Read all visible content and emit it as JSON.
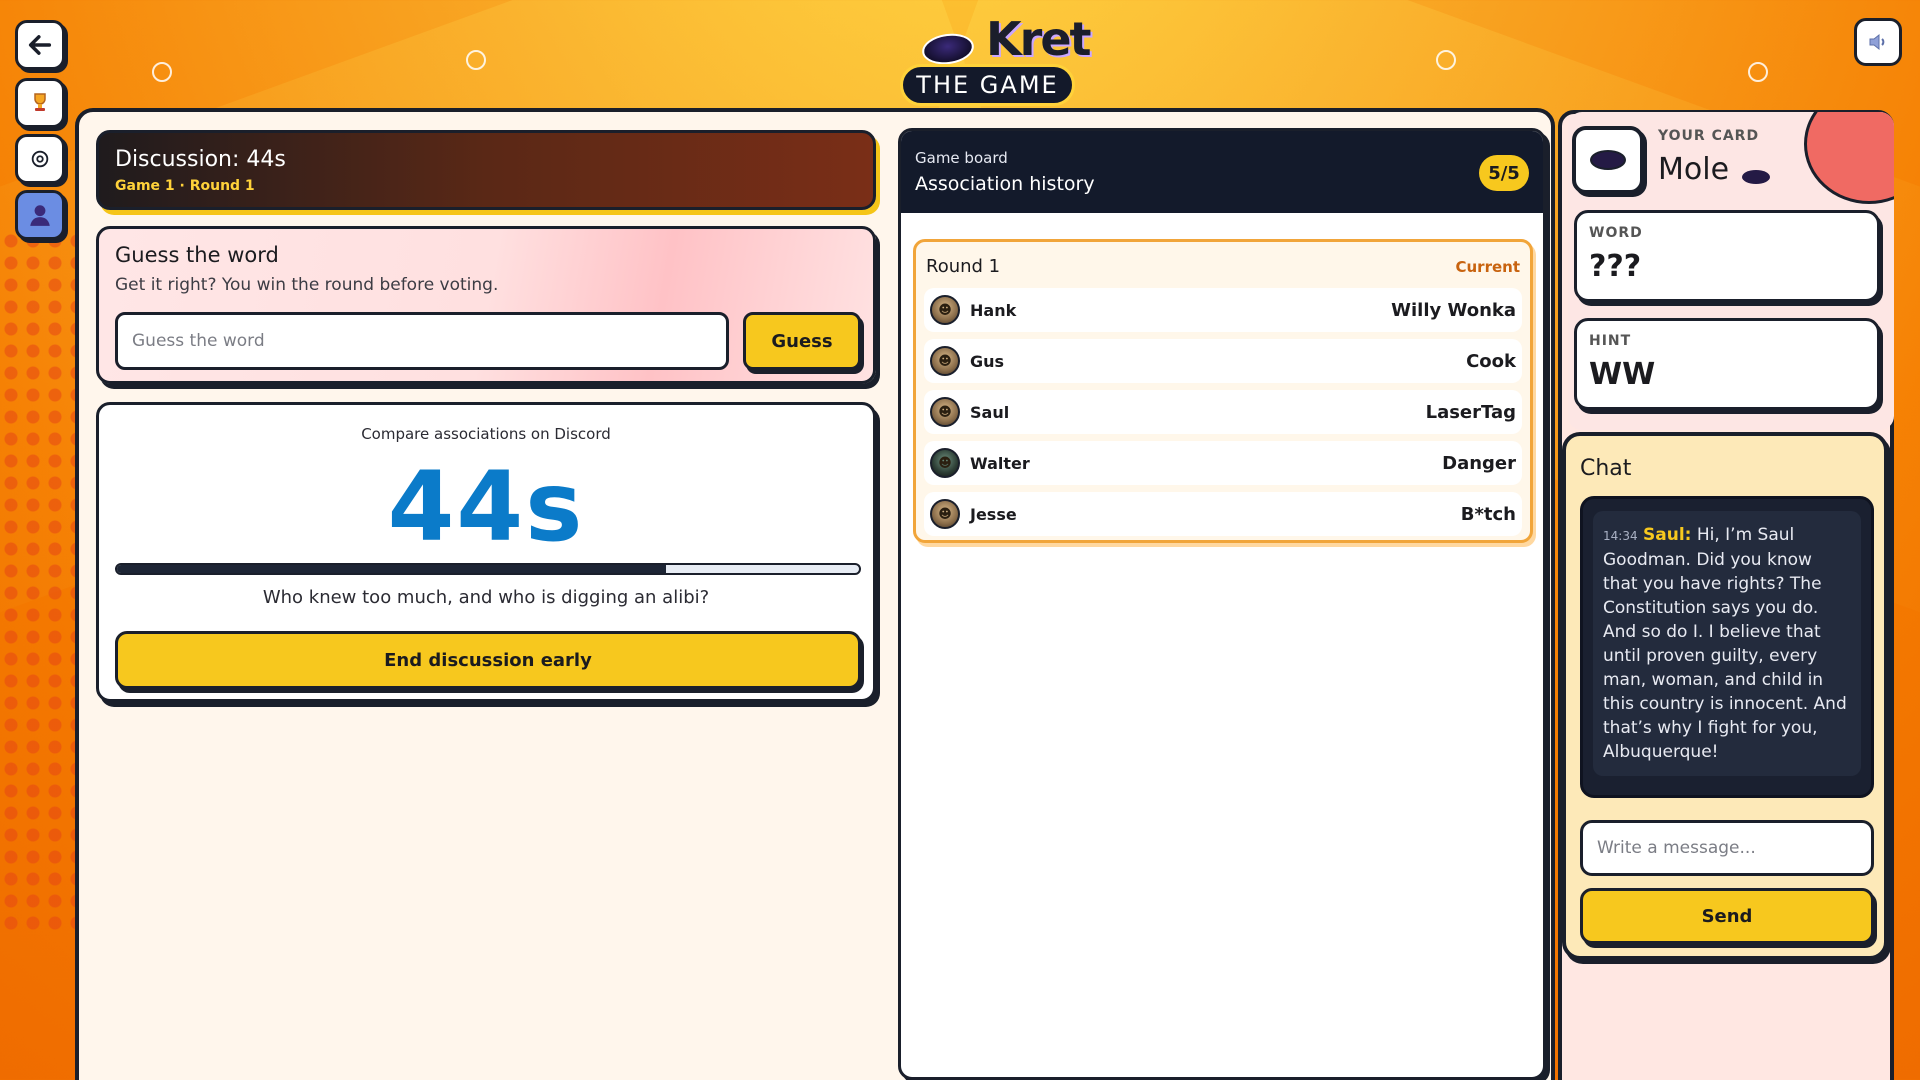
{
  "logo": {
    "brand": "Kret",
    "subtitle": "THE GAME"
  },
  "rail": {
    "back_icon": "arrow-left-icon",
    "trophy_icon": "trophy-icon",
    "settings_icon": "gear-icon",
    "profile_icon": "user-icon"
  },
  "sound_icon": "speaker-icon",
  "discussion": {
    "title": "Discussion: 44s",
    "subtitle": "Game 1 · Round 1"
  },
  "guess": {
    "title": "Guess the word",
    "description": "Get it right? You win the round before voting.",
    "input_placeholder": "Guess the word",
    "input_value": "",
    "button_label": "Guess"
  },
  "timer": {
    "caption": "Compare associations on Discord",
    "value": "44s",
    "progress_fraction": 0.74,
    "question": "Who knew too much, and who is digging an alibi?",
    "end_button_label": "End discussion early"
  },
  "board": {
    "caption": "Game board",
    "title": "Association history",
    "count_badge": "5/5",
    "rounds": [
      {
        "title": "Round 1",
        "status": "Current",
        "associations": [
          {
            "player": "Hank",
            "word": "Willy Wonka"
          },
          {
            "player": "Gus",
            "word": "Cook"
          },
          {
            "player": "Saul",
            "word": "LaserTag"
          },
          {
            "player": "Walter",
            "word": "Danger"
          },
          {
            "player": "Jesse",
            "word": "B*tch"
          }
        ]
      }
    ]
  },
  "your_card": {
    "label": "YOUR CARD",
    "role": "Mole",
    "word_label": "WORD",
    "word_value": "???",
    "hint_label": "HINT",
    "hint_value": "WW"
  },
  "chat": {
    "title": "Chat",
    "messages": [
      {
        "time": "14:34",
        "author": "Saul:",
        "text": " Hi, I’m Saul Goodman. Did you know that you have rights? The Constitution says you do. And so do I. I believe that until proven guilty, every man, woman, and child in this country is innocent. And that’s why I fight for you, Albuquerque!"
      }
    ],
    "input_placeholder": "Write a message...",
    "input_value": "",
    "send_label": "Send"
  },
  "colors": {
    "accent_yellow": "#f7c81e",
    "timer_blue": "#0b7bc9",
    "dark_navy": "#131a2b",
    "current_orange": "#c8630f"
  }
}
